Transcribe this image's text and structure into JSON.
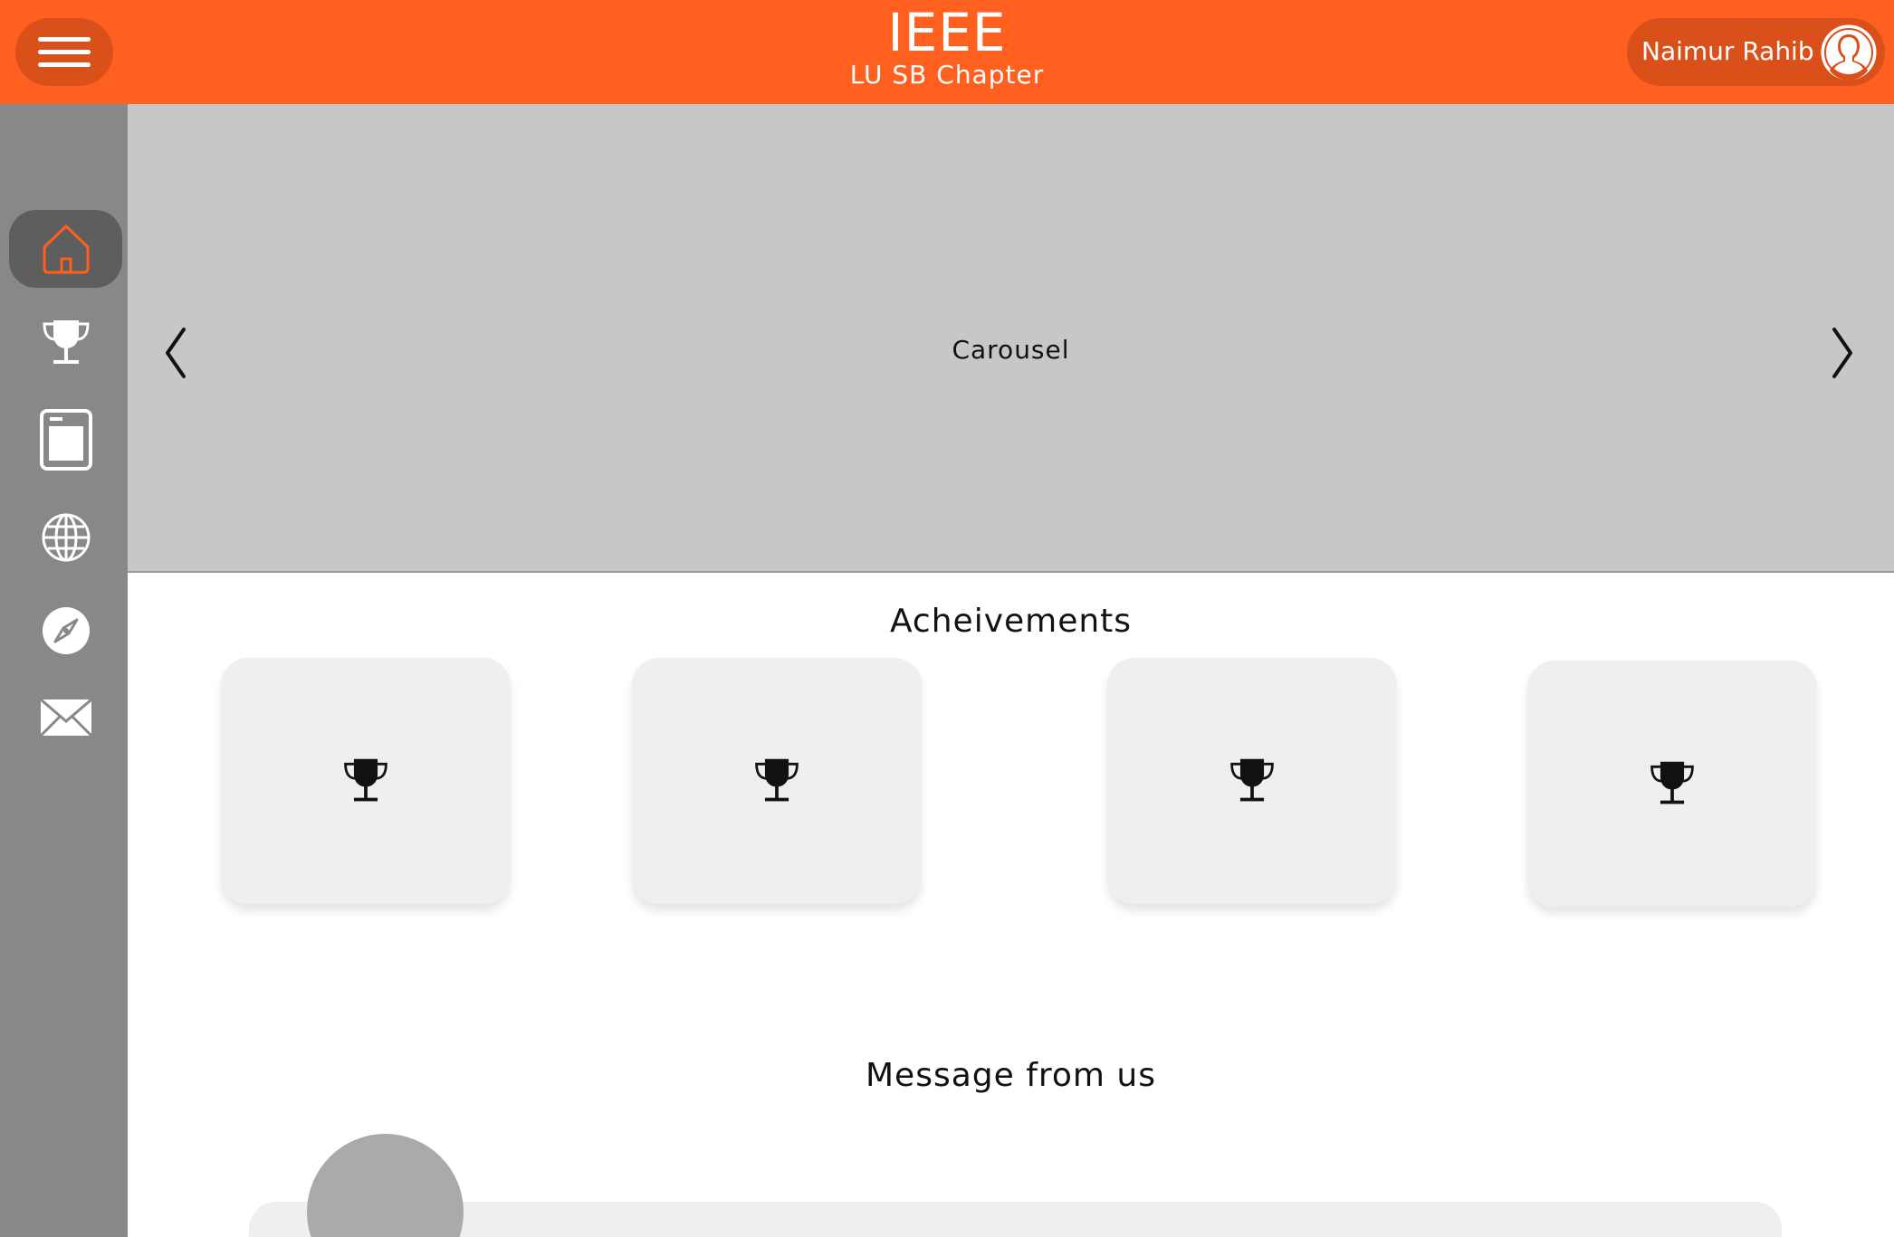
{
  "header": {
    "title": "IEEE",
    "subtitle": "LU SB Chapter",
    "menu_icon": "hamburger-icon",
    "user": {
      "name": "Naimur Rahib",
      "avatar_icon": "user-avatar-icon"
    },
    "background_color": "#ff5f1f",
    "pill_color": "#d9501a"
  },
  "sidebar": {
    "background_color": "#888888",
    "active_color": "#5e5e5e",
    "items": [
      {
        "id": "home",
        "icon": "home-icon",
        "active": true
      },
      {
        "id": "achievements",
        "icon": "trophy-icon",
        "active": false
      },
      {
        "id": "pages",
        "icon": "tablet-icon",
        "active": false
      },
      {
        "id": "web",
        "icon": "globe-icon",
        "active": false
      },
      {
        "id": "explore",
        "icon": "compass-icon",
        "active": false
      },
      {
        "id": "contact",
        "icon": "mail-icon",
        "active": false
      }
    ]
  },
  "carousel": {
    "label": "Carousel",
    "prev_icon": "chevron-left-icon",
    "next_icon": "chevron-right-icon"
  },
  "achievements": {
    "title": "Acheivements",
    "cards": [
      {
        "icon": "trophy-icon"
      },
      {
        "icon": "trophy-icon"
      },
      {
        "icon": "trophy-icon"
      },
      {
        "icon": "trophy-icon"
      }
    ]
  },
  "message": {
    "title": "Message from us"
  }
}
